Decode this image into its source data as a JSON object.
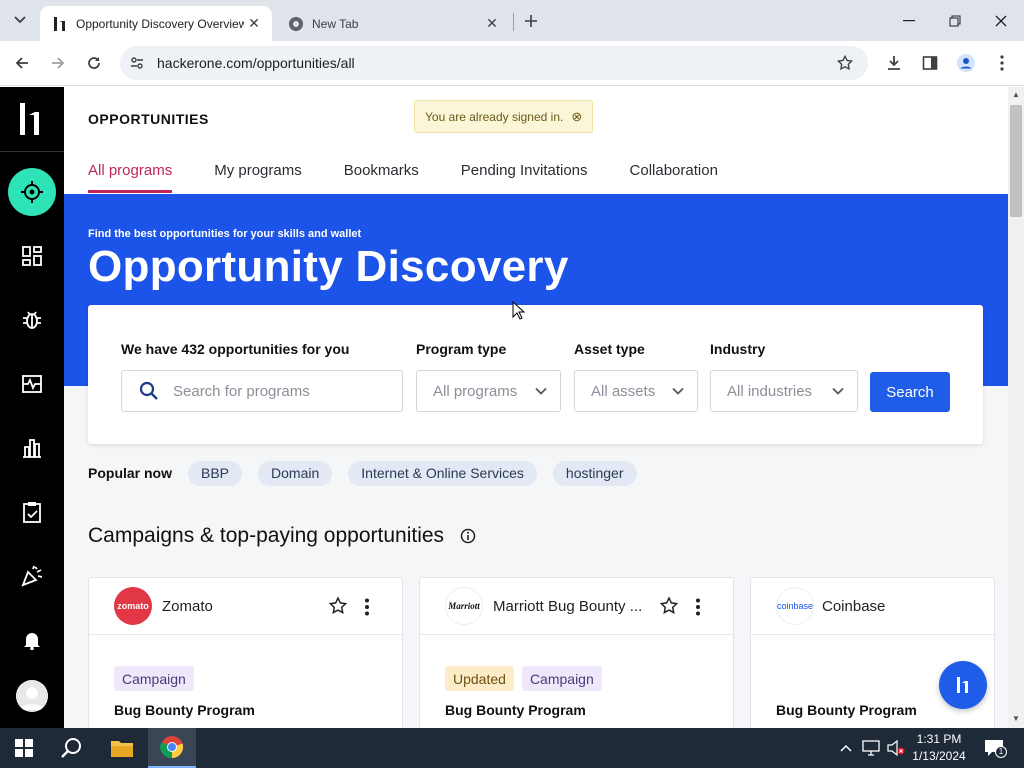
{
  "browser": {
    "tabs": [
      {
        "title": "Opportunity Discovery Overview",
        "active": true
      },
      {
        "title": "New Tab",
        "active": false
      }
    ],
    "url": "hackerone.com/opportunities/all"
  },
  "page": {
    "label": "OPPORTUNITIES",
    "signed_in_notice": "You are already signed in.",
    "tabs": [
      "All programs",
      "My programs",
      "Bookmarks",
      "Pending Invitations",
      "Collaboration"
    ],
    "active_tab": "All programs"
  },
  "hero": {
    "subtitle": "Find the best opportunities for your skills and wallet",
    "title": "Opportunity Discovery"
  },
  "search": {
    "count_label": "We have 432 opportunities for you",
    "placeholder": "Search for programs",
    "program_type_label": "Program type",
    "program_type_value": "All programs",
    "asset_type_label": "Asset type",
    "asset_type_value": "All assets",
    "industry_label": "Industry",
    "industry_value": "All industries",
    "button": "Search"
  },
  "popular": {
    "label": "Popular now",
    "chips": [
      "BBP",
      "Domain",
      "Internet & Online Services",
      "hostinger"
    ]
  },
  "campaigns": {
    "title": "Campaigns & top-paying opportunities",
    "cards": [
      {
        "name": "Zomato",
        "logo_text": "zomato",
        "tags": [
          "Campaign"
        ],
        "type": "Bug Bounty Program"
      },
      {
        "name": "Marriott Bug Bounty ...",
        "logo_text": "Marriott",
        "tags": [
          "Updated",
          "Campaign"
        ],
        "type": "Bug Bounty Program"
      },
      {
        "name": "Coinbase",
        "logo_text": "coinbase",
        "tags": [],
        "type": "Bug Bounty Program"
      }
    ]
  },
  "taskbar": {
    "time": "1:31 PM",
    "date": "1/13/2024",
    "notifications": "1"
  },
  "colors": {
    "brand_accent": "#c22657",
    "hero_blue": "#1c53e8",
    "button_blue": "#1f5de8",
    "sidebar_active": "#2ee3b6"
  }
}
